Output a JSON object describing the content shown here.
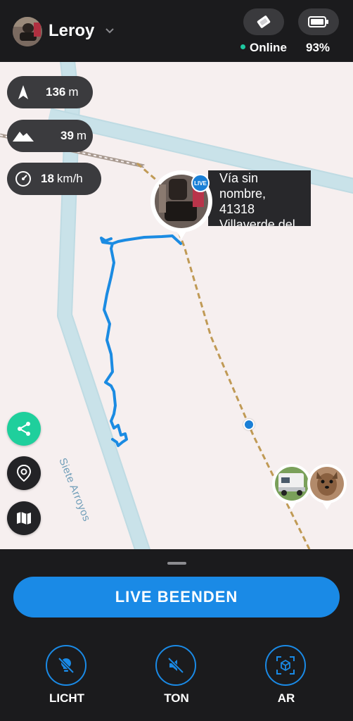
{
  "header": {
    "user_name": "Leroy",
    "connection_status": "Online",
    "battery_level": "93%",
    "status_color": "#1ec8a0"
  },
  "map": {
    "street_name": "Siete Arroyos",
    "stats": {
      "direction": {
        "value": "136",
        "unit": "m",
        "icon": "compass-arrow-icon"
      },
      "elevation": {
        "value": "39",
        "unit": "m",
        "icon": "mountain-icon"
      },
      "speed": {
        "value": "18",
        "unit": "km/h",
        "icon": "speedometer-icon"
      }
    },
    "live_pin": {
      "badge": "LIVE",
      "address_lines": [
        "Vía sin",
        "nombre,",
        "41318",
        "Villaverde del"
      ]
    },
    "accent_color": "#1a8ae6",
    "track_color": "#1b8be2"
  },
  "actions": {
    "share_icon": "share-icon",
    "location_icon": "location-pin-icon",
    "map_icon": "map-icon"
  },
  "bottom": {
    "live_button_label": "LIVE BEENDEN",
    "controls": [
      {
        "label": "LICHT",
        "icon": "light-off-icon"
      },
      {
        "label": "TON",
        "icon": "sound-off-icon"
      },
      {
        "label": "AR",
        "icon": "ar-cube-icon"
      }
    ]
  }
}
